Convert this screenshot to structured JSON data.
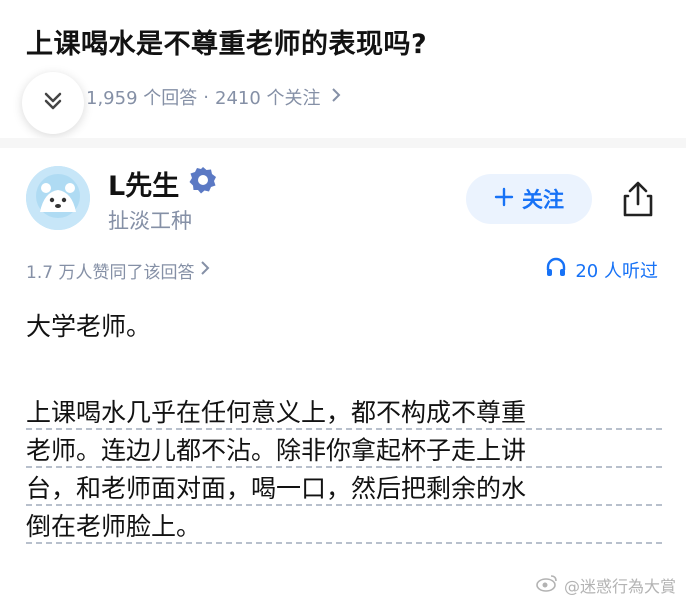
{
  "question": {
    "title": "上课喝水是不尊重老师的表现吗?",
    "answers_count": "1,959 个回答",
    "separator": "·",
    "followers_count": "2410 个关注"
  },
  "author": {
    "name": "L先生",
    "bio": "扯淡工种",
    "follow_label": "关注",
    "follow_icon": "plus-icon",
    "badge_icon": "verified-badge-icon",
    "share_icon": "share-icon"
  },
  "answer": {
    "upvote_text": "1.7 万人赞同了该回答",
    "listen_text": "20 人听过",
    "listen_icon": "headphones-icon",
    "paragraph1": "大学老师。",
    "paragraph2_lines": [
      "上课喝水几乎在任何意义上，都不构成不尊重",
      "老师。连边儿都不沾。除非你拿起杯子走上讲",
      "台，和老师面对面，喝一口，然后把剩余的水",
      "倒在老师脸上。"
    ]
  },
  "watermark": {
    "text": "@迷惑行為大賞"
  },
  "colors": {
    "accent": "#1772f6",
    "meta_gray": "#8590a6",
    "follow_bg": "#ebf3fe",
    "text": "#121212"
  }
}
